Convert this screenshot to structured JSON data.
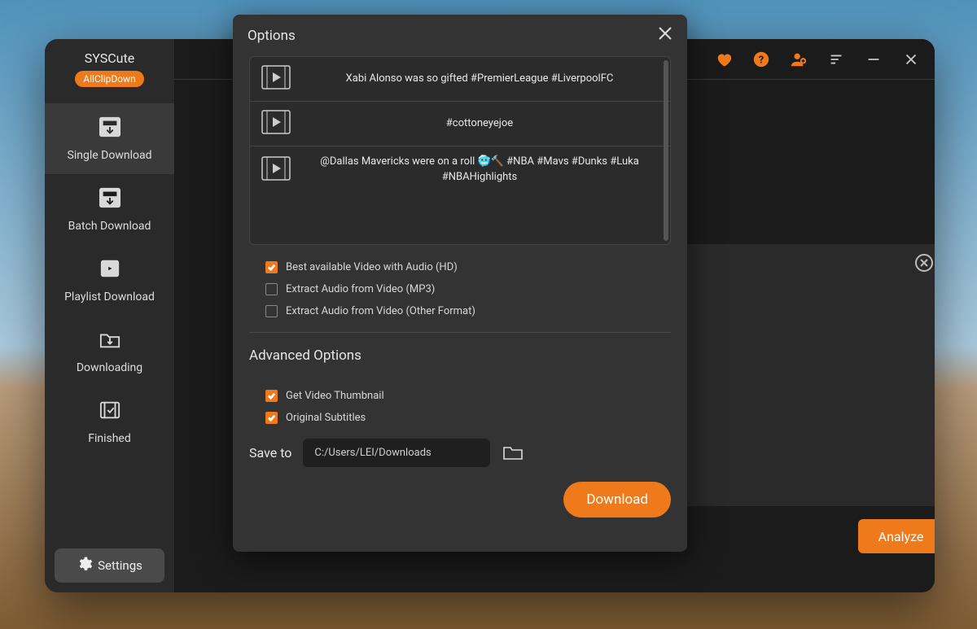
{
  "brand": {
    "title": "SYSCute",
    "subtitle": "AllClipDown"
  },
  "sidebar": {
    "items": [
      {
        "label": "Single Download",
        "icon": "download-file-icon"
      },
      {
        "label": "Batch Download",
        "icon": "download-file-icon"
      },
      {
        "label": "Playlist Download",
        "icon": "playlist-icon"
      },
      {
        "label": "Downloading",
        "icon": "folder-down-icon"
      },
      {
        "label": "Finished",
        "icon": "film-check-icon"
      }
    ],
    "settings_label": "Settings"
  },
  "titlebar": {
    "icons": [
      "heart-icon",
      "help-icon",
      "add-user-icon",
      "menu-icon",
      "minimize-icon",
      "close-icon"
    ]
  },
  "url_panel": {
    "close_label": "close"
  },
  "analyze_label": "Analyze",
  "modal": {
    "title": "Options",
    "videos": [
      {
        "title": "Xabi Alonso was so gifted     #PremierLeague #LiverpoolFC"
      },
      {
        "title": "#cottoneyejoe"
      },
      {
        "title": "@Dallas Mavericks were on a roll 🥶🔨 #NBA #Mavs #Dunks #Luka #NBAHighlights"
      }
    ],
    "format_options": [
      {
        "label": "Best available Video with Audio (HD)",
        "checked": true
      },
      {
        "label": "Extract Audio from Video (MP3)",
        "checked": false
      },
      {
        "label": "Extract Audio from Video  (Other Format)",
        "checked": false
      }
    ],
    "advanced_title": "Advanced Options",
    "advanced_options": [
      {
        "label": "Get Video Thumbnail",
        "checked": true
      },
      {
        "label": "Original Subtitles",
        "checked": true
      }
    ],
    "save_to_label": "Save to",
    "save_path": "C:/Users/LEI/Downloads",
    "download_label": "Download"
  }
}
